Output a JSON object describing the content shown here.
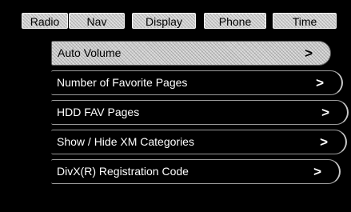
{
  "tabs": [
    {
      "label": "Radio"
    },
    {
      "label": "Nav"
    },
    {
      "label": "Display"
    },
    {
      "label": "Phone"
    },
    {
      "label": "Time"
    }
  ],
  "menu": {
    "items": [
      {
        "label": "Auto Volume",
        "chevron": ">",
        "selected": true
      },
      {
        "label": "Number of Favorite Pages",
        "chevron": ">",
        "selected": false
      },
      {
        "label": "HDD FAV Pages",
        "chevron": ">",
        "selected": false
      },
      {
        "label": "Show / Hide XM Categories",
        "chevron": ">",
        "selected": false
      },
      {
        "label": "DivX(R) Registration Code",
        "chevron": ">",
        "selected": false
      }
    ]
  },
  "colors": {
    "background": "#000000",
    "tab": "#d6d6d6",
    "selected_item": "#cfcfcf",
    "item_text": "#ffffff"
  }
}
